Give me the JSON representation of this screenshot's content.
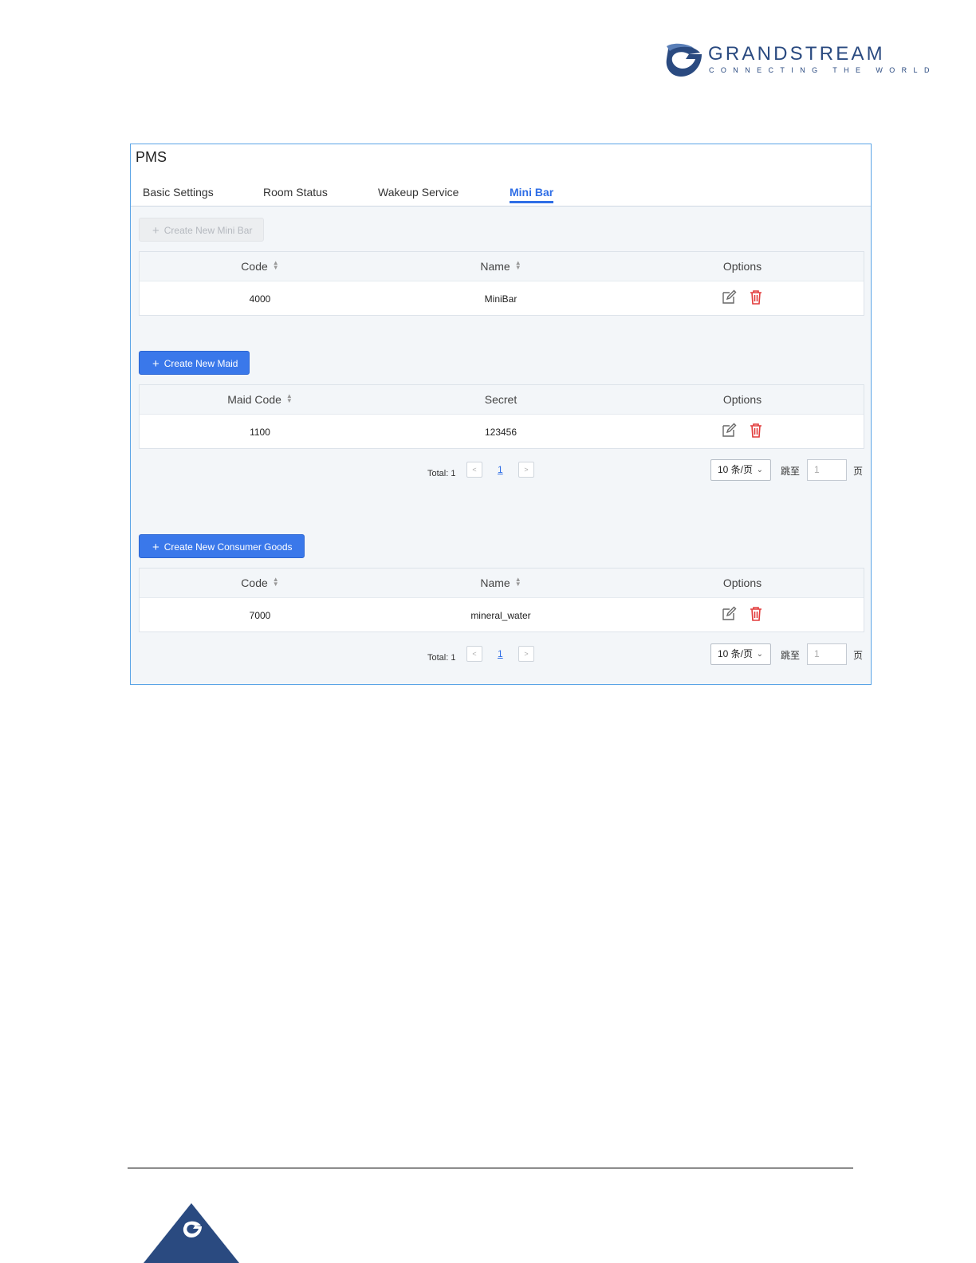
{
  "brand": {
    "name": "GRANDSTREAM",
    "tagline": "CONNECTING THE WORLD",
    "color": "#2a4a80"
  },
  "panel": {
    "title": "PMS",
    "tabs": [
      {
        "label": "Basic Settings",
        "active": false
      },
      {
        "label": "Room Status",
        "active": false
      },
      {
        "label": "Wakeup Service",
        "active": false
      },
      {
        "label": "Mini Bar",
        "active": true
      }
    ]
  },
  "minibar": {
    "create_label": "Create New Mini Bar",
    "columns": [
      "Code",
      "Name",
      "Options"
    ],
    "rows": [
      {
        "code": "4000",
        "name": "MiniBar"
      }
    ]
  },
  "maid": {
    "create_label": "Create New Maid",
    "columns": [
      "Maid Code",
      "Secret",
      "Options"
    ],
    "rows": [
      {
        "code": "1100",
        "secret": "123456"
      }
    ],
    "pager": {
      "total_label": "Total: 1",
      "prev": "<",
      "page": "1",
      "next": ">",
      "page_size": "10 条/页",
      "goto_label": "跳至",
      "goto_value": "1",
      "page_suffix": "页"
    }
  },
  "goods": {
    "create_label": "Create New Consumer Goods",
    "columns": [
      "Code",
      "Name",
      "Options"
    ],
    "rows": [
      {
        "code": "7000",
        "name": "mineral_water"
      }
    ],
    "pager": {
      "total_label": "Total: 1",
      "prev": "<",
      "page": "1",
      "next": ">",
      "page_size": "10 条/页",
      "goto_label": "跳至",
      "goto_value": "1",
      "page_suffix": "页"
    }
  },
  "icons": {
    "plus": "+",
    "edit": "edit-icon",
    "delete": "trash-icon",
    "sort": "sort-icon",
    "chevron": "chevron-down-icon"
  },
  "colors": {
    "accent": "#2f6ee6",
    "primary_button": "#3a78ea",
    "delete": "#e23b3b",
    "panel_border": "#5aa4e6"
  }
}
